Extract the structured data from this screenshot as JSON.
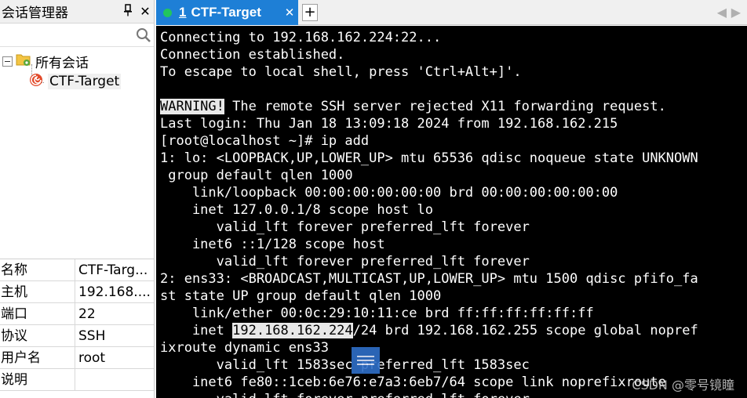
{
  "left_panel": {
    "title": "会话管理器",
    "pin_icon": "pin-icon",
    "close_icon": "close-icon",
    "search": {
      "value": "",
      "placeholder": ""
    },
    "tree": {
      "root_label": "所有会话",
      "child_label": "CTF-Target"
    },
    "properties": [
      {
        "key": "名称",
        "value": "CTF-Targ..."
      },
      {
        "key": "主机",
        "value": "192.168...."
      },
      {
        "key": "端口",
        "value": "22"
      },
      {
        "key": "协议",
        "value": "SSH"
      },
      {
        "key": "用户名",
        "value": "root"
      },
      {
        "key": "说明",
        "value": ""
      }
    ]
  },
  "tabs": {
    "active": {
      "number": "1",
      "label": "CTF-Target",
      "close": "✕",
      "status_color": "#22c55e"
    },
    "new_tab": "+",
    "nav_left": "◀",
    "nav_right": "▶"
  },
  "terminal": {
    "lines": [
      "Connecting to 192.168.162.224:22...",
      "Connection established.",
      "To escape to local shell, press 'Ctrl+Alt+]'.",
      "",
      {
        "hl": "WARNING!",
        "rest": " The remote SSH server rejected X11 forwarding request."
      },
      "Last login: Thu Jan 18 13:09:18 2024 from 192.168.162.215",
      "[root@localhost ~]# ip add",
      "1: lo: <LOOPBACK,UP,LOWER_UP> mtu 65536 qdisc noqueue state UNKNOWN",
      " group default qlen 1000",
      "    link/loopback 00:00:00:00:00:00 brd 00:00:00:00:00:00",
      "    inet 127.0.0.1/8 scope host lo",
      "       valid_lft forever preferred_lft forever",
      "    inet6 ::1/128 scope host",
      "       valid_lft forever preferred_lft forever",
      "2: ens33: <BROADCAST,MULTICAST,UP,LOWER_UP> mtu 1500 qdisc pfifo_fa",
      "st state UP group default qlen 1000",
      "    link/ether 00:0c:29:10:11:ce brd ff:ff:ff:ff:ff:ff",
      {
        "pre": "    inet ",
        "hl": "192.168.162.224",
        "rest": "/24 brd 192.168.162.255 scope global nopref"
      },
      "ixroute dynamic ens33",
      "       valid_lft 1583sec preferred_lft 1583sec",
      "    inet6 fe80::1ceb:6e76:e7a3:6eb7/64 scope link noprefixroute",
      "       valid_lft forever preferred_lft forever"
    ]
  },
  "floating_button_icon": "menu-icon",
  "watermark": "CSDN @零号镜瞳",
  "colors": {
    "tab_active": "#1e7fd6",
    "terminal_bg": "#000000",
    "terminal_fg": "#ffffff"
  }
}
